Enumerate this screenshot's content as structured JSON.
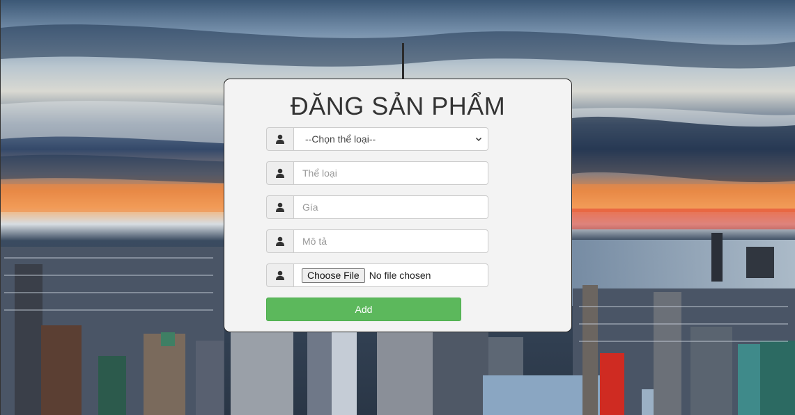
{
  "form": {
    "title": "ĐĂNG SẢN PHẨM",
    "category_select": {
      "selected": "--Chọn thể loại--"
    },
    "category_input": {
      "placeholder": "Thể loại"
    },
    "price_input": {
      "placeholder": "Gía"
    },
    "description_input": {
      "placeholder": "Mô tả"
    },
    "file_input": {
      "button_label": "Choose File",
      "status": "No file chosen"
    },
    "submit_label": "Add"
  },
  "icons": {
    "field_icon": "user-icon",
    "select_arrow": "chevron-down-icon"
  },
  "colors": {
    "card_background": "#f3f3f3",
    "submit_button": "#5cb85c",
    "title_text": "#333333"
  }
}
